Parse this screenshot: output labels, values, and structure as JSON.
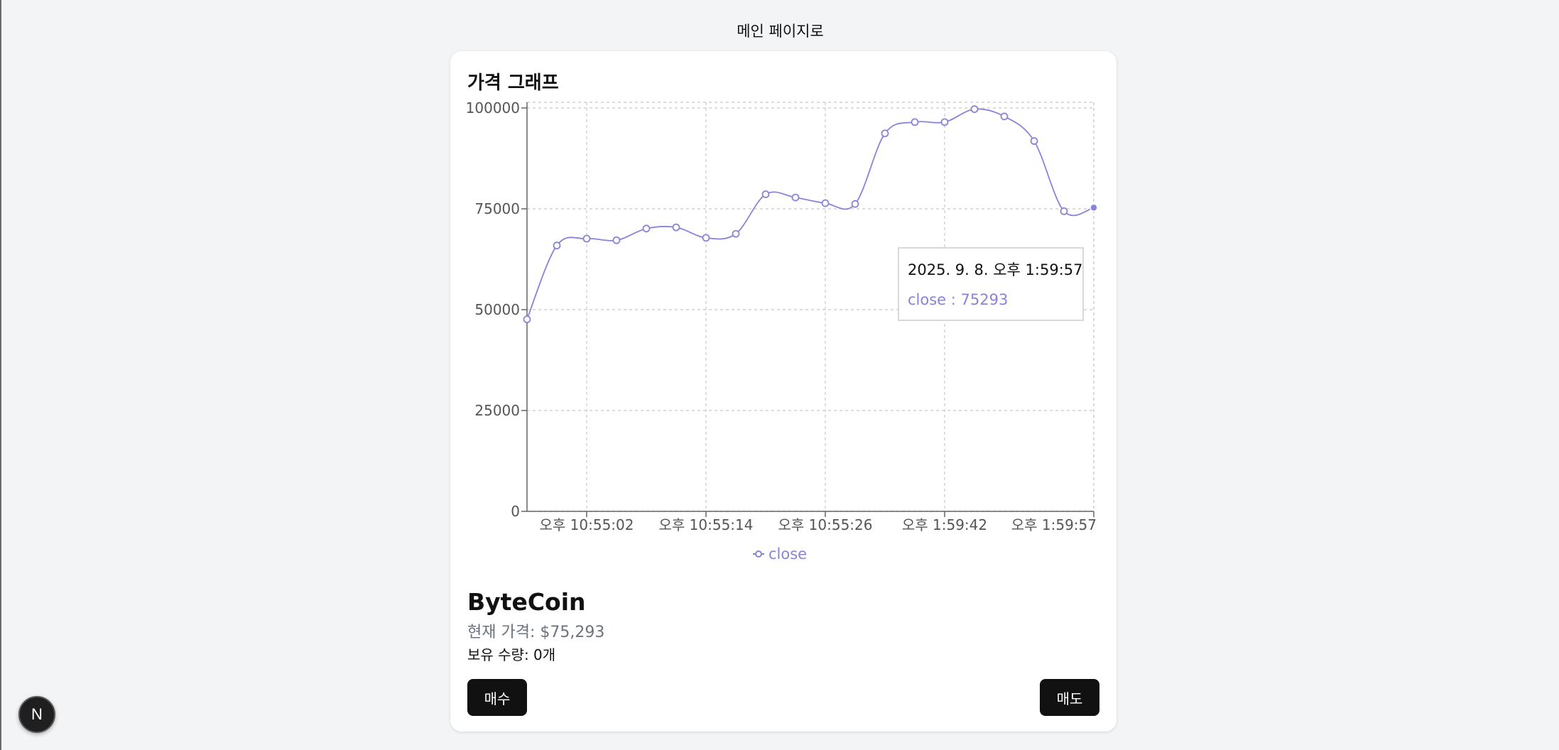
{
  "nav": {
    "back_label": "메인 페이지로"
  },
  "chart_section": {
    "title": "가격 그래프"
  },
  "chart_data": {
    "type": "line",
    "title": "",
    "xlabel": "",
    "ylabel": "",
    "ylim": [
      0,
      100000
    ],
    "y_ticks": [
      0,
      25000,
      50000,
      75000,
      100000
    ],
    "x_tick_labels": [
      "오후 10:55:02",
      "오후 10:55:14",
      "오후 10:55:26",
      "오후 1:59:42",
      "오후 1:59:57"
    ],
    "grid": true,
    "legend": "bottom-center",
    "line_color": "#8884d8",
    "series": [
      {
        "name": "close",
        "values": [
          47600,
          65900,
          67600,
          67200,
          70100,
          70400,
          67800,
          68800,
          78600,
          77800,
          76400,
          76200,
          93700,
          96500,
          96500,
          99700,
          97900,
          91800,
          74400,
          75293
        ]
      }
    ],
    "x_tick_indices": [
      2,
      6,
      10,
      14,
      19
    ],
    "active_index": 19,
    "tooltip": {
      "label": "2025. 9. 8. 오후 1:59:57",
      "series_name": "close",
      "value": "75293",
      "text": "close : 75293"
    }
  },
  "coin": {
    "name": "ByteCoin",
    "price_text": "현재 가격: $75,293",
    "holding_text": "보유 수량: 0개"
  },
  "actions": {
    "buy_label": "매수",
    "sell_label": "매도"
  },
  "badge": {
    "letter": "N"
  }
}
